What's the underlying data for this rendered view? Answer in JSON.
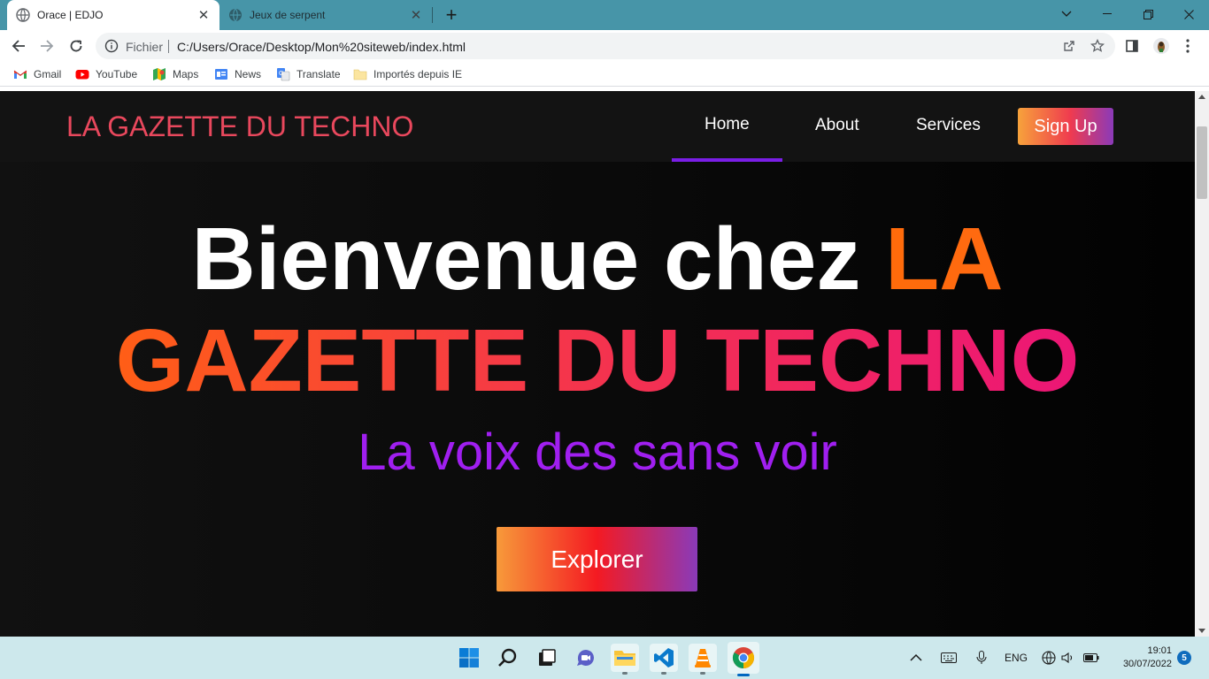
{
  "browser": {
    "tabs": [
      {
        "title": "Orace | EDJO",
        "active": true
      },
      {
        "title": "Jeux de serpent",
        "active": false
      }
    ],
    "address": {
      "scheme_label": "Fichier",
      "url": "C:/Users/Orace/Desktop/Mon%20siteweb/index.html"
    },
    "bookmarks": [
      {
        "label": "Gmail",
        "icon": "gmail-icon"
      },
      {
        "label": "YouTube",
        "icon": "youtube-icon"
      },
      {
        "label": "Maps",
        "icon": "maps-icon"
      },
      {
        "label": "News",
        "icon": "news-icon"
      },
      {
        "label": "Translate",
        "icon": "translate-icon"
      },
      {
        "label": "Importés depuis IE",
        "icon": "folder-icon"
      }
    ]
  },
  "site": {
    "brand": "LA GAZETTE DU TECHNO",
    "nav": {
      "home": "Home",
      "about": "About",
      "services": "Services",
      "signup": "Sign Up",
      "active": "Home"
    },
    "hero": {
      "title_part1": "Bienvenue chez",
      "title_part2": "LA",
      "title_part3": "GAZETTE DU TECHNO",
      "subtitle": "La voix des sans voir",
      "cta": "Explorer"
    },
    "colors": {
      "brand": "#e9485d",
      "accent_purple": "#a01ff0",
      "underline": "#7a1ee6",
      "orange": "#ff6b0a",
      "pink": "#ec1676"
    }
  },
  "taskbar": {
    "apps": [
      "start-icon",
      "search-icon",
      "task-view-icon",
      "chat-icon",
      "file-explorer-icon",
      "vscode-icon",
      "vlc-icon",
      "chrome-icon"
    ],
    "language": "ENG",
    "time": "19:01",
    "date": "30/07/2022",
    "notifications": "5"
  }
}
